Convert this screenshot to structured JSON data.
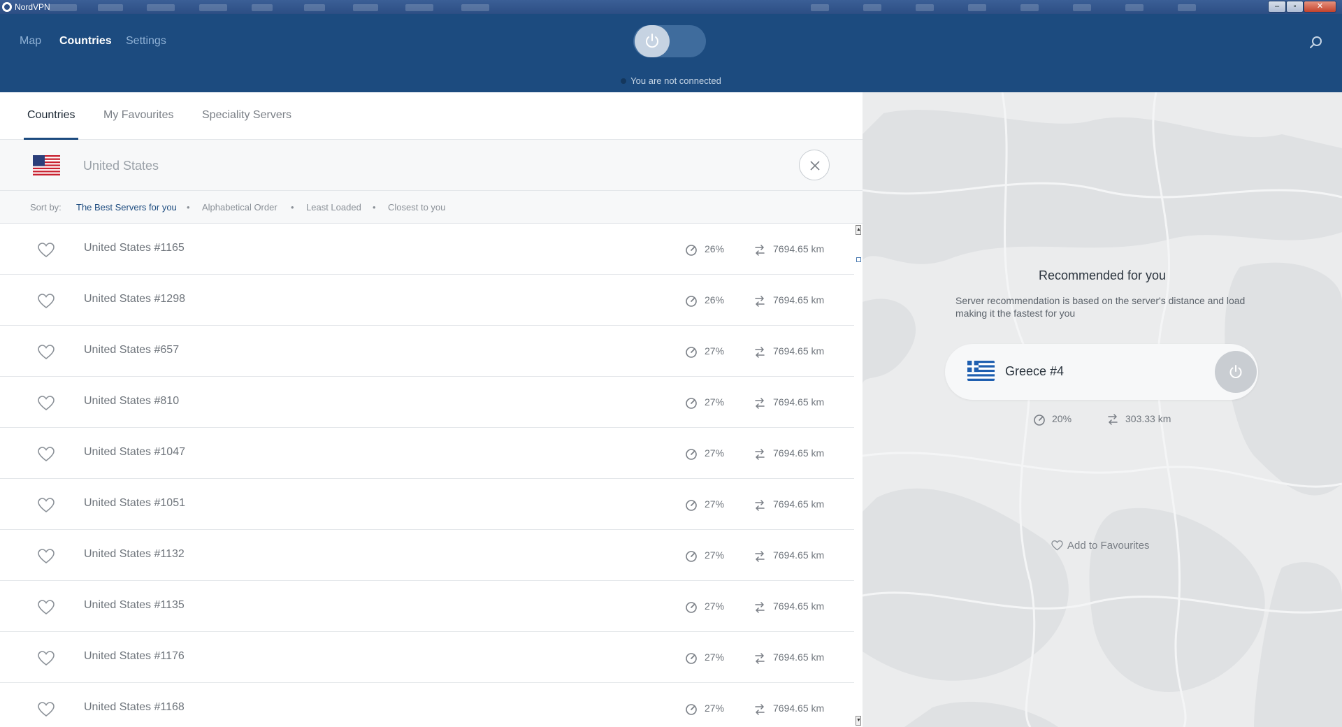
{
  "window": {
    "title": "NordVPN"
  },
  "nav": {
    "map": "Map",
    "countries": "Countries",
    "settings": "Settings"
  },
  "status": {
    "text": "You are not connected"
  },
  "tabs": [
    {
      "label": "Countries"
    },
    {
      "label": "My Favourites"
    },
    {
      "label": "Speciality Servers"
    }
  ],
  "search": {
    "placeholder": "United States",
    "value": ""
  },
  "sort": {
    "label": "Sort by:",
    "options": [
      "The Best Servers for you",
      "Alphabetical Order",
      "Least Loaded",
      "Closest to you"
    ]
  },
  "servers": [
    {
      "name": "United States #1165",
      "load": "26%",
      "distance": "7694.65 km"
    },
    {
      "name": "United States #1298",
      "load": "26%",
      "distance": "7694.65 km"
    },
    {
      "name": "United States #657",
      "load": "27%",
      "distance": "7694.65 km"
    },
    {
      "name": "United States #810",
      "load": "27%",
      "distance": "7694.65 km"
    },
    {
      "name": "United States #1047",
      "load": "27%",
      "distance": "7694.65 km"
    },
    {
      "name": "United States #1051",
      "load": "27%",
      "distance": "7694.65 km"
    },
    {
      "name": "United States #1132",
      "load": "27%",
      "distance": "7694.65 km"
    },
    {
      "name": "United States #1135",
      "load": "27%",
      "distance": "7694.65 km"
    },
    {
      "name": "United States #1176",
      "load": "27%",
      "distance": "7694.65 km"
    },
    {
      "name": "United States #1168",
      "load": "27%",
      "distance": "7694.65 km"
    }
  ],
  "recommended": {
    "title": "Recommended for you",
    "description": "Server recommendation is based on the server's distance and load making it the fastest for you",
    "server": "Greece #4",
    "load": "20%",
    "distance": "303.33 km",
    "favourite_label": "Add to Favourites"
  },
  "colors": {
    "header": "#1c4b7f",
    "accent": "#1c4b7f"
  }
}
